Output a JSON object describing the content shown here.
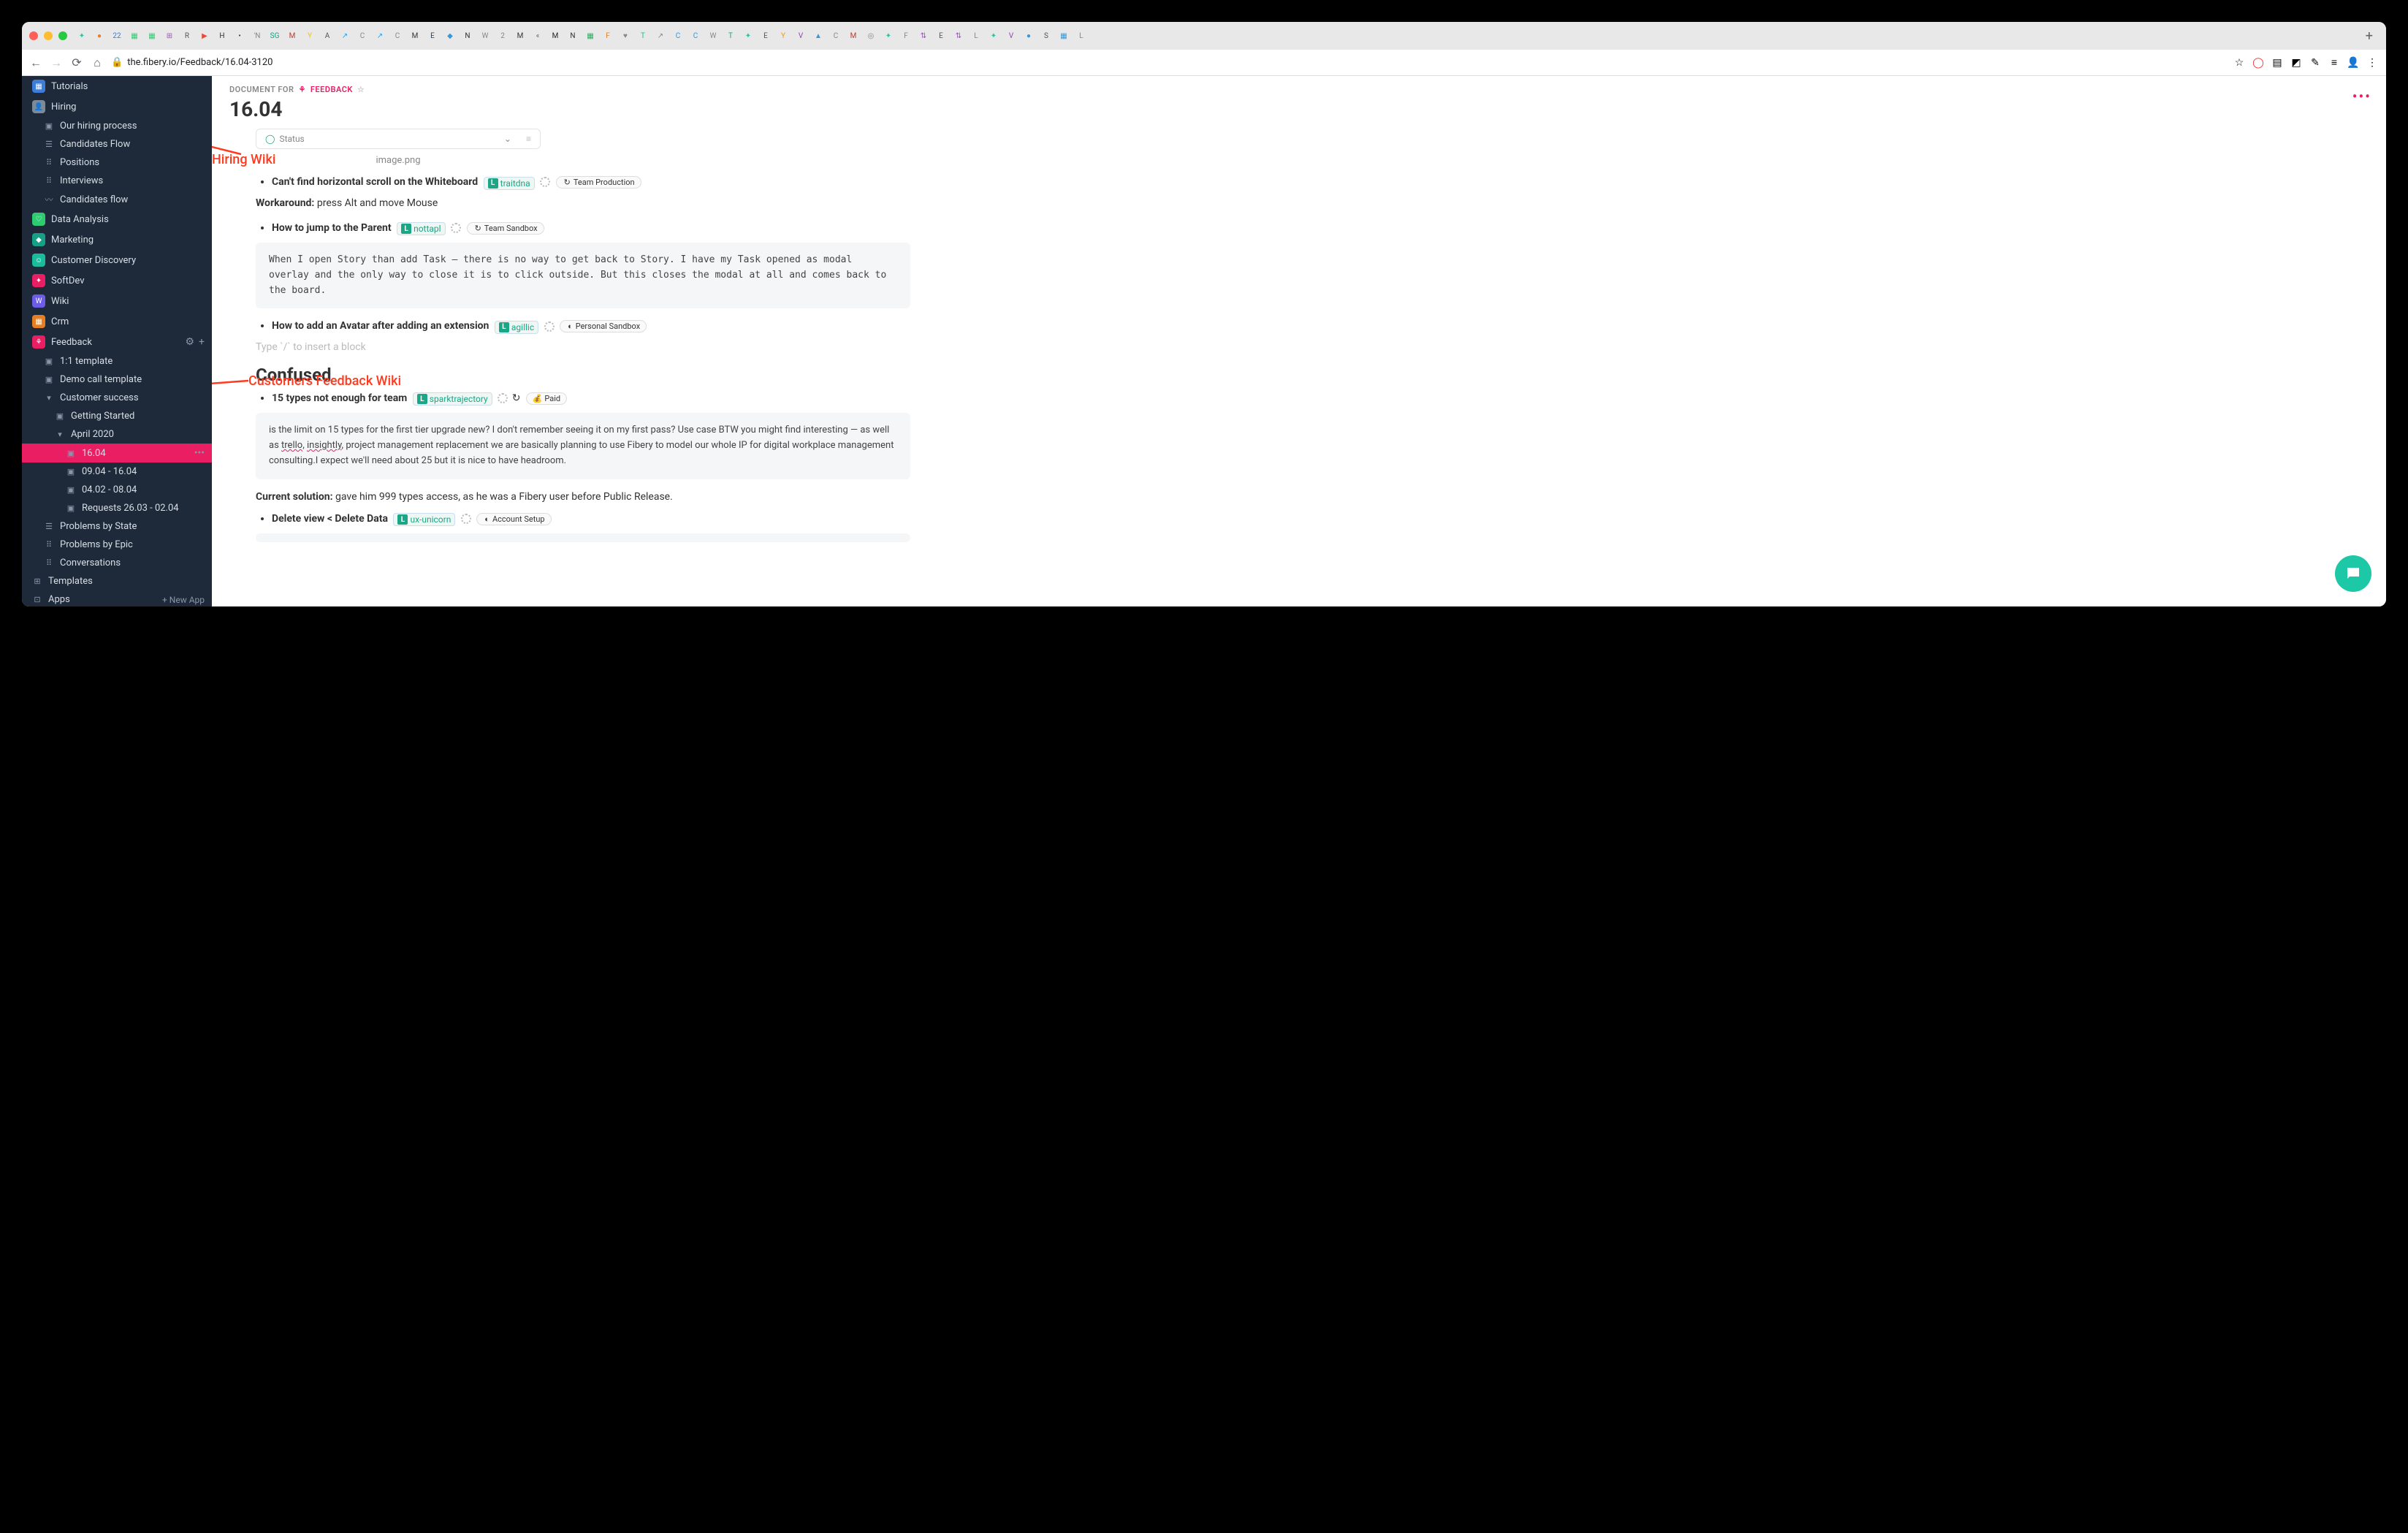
{
  "browser": {
    "url": "the.fibery.io/Feedback/16.04-3120",
    "tabs_symbols": [
      "✦",
      "●",
      "22",
      "▦",
      "▦",
      "⊞",
      "R",
      "▶",
      "H",
      "•",
      "'N",
      "SG",
      "M",
      "Y",
      "A",
      "↗",
      "C",
      "↗",
      "C",
      "M",
      "E",
      "◆",
      "N",
      "W",
      "2",
      "M",
      "«",
      "M",
      "N",
      "▦",
      "F",
      "♥",
      "T",
      "↗",
      "C",
      "C",
      "W",
      "T",
      "✦",
      "E",
      "Y",
      "V",
      "▲",
      "C",
      "M",
      "◎",
      "✦",
      "F",
      "⇅",
      "E",
      "⇅",
      "L",
      "✦",
      "V",
      "●",
      "S",
      "▦",
      "L"
    ],
    "plus": "+"
  },
  "sidebar": {
    "top": [
      {
        "icon_bg": "#3b7dd8",
        "glyph": "▦",
        "label": "Tutorials"
      },
      {
        "icon_bg": "#7a8a99",
        "glyph": "👤",
        "label": "Hiring"
      }
    ],
    "hiring_children": [
      {
        "g": "▣",
        "label": "Our hiring process"
      },
      {
        "g": "☰",
        "label": "Candidates Flow"
      },
      {
        "g": "⠿",
        "label": "Positions"
      },
      {
        "g": "⠿",
        "label": "Interviews"
      },
      {
        "g": "〰",
        "label": "Candidates flow"
      }
    ],
    "spaces": [
      {
        "icon_bg": "#2ecc71",
        "glyph": "♡",
        "label": "Data Analysis"
      },
      {
        "icon_bg": "#16a085",
        "glyph": "◆",
        "label": "Marketing"
      },
      {
        "icon_bg": "#1abc9c",
        "glyph": "☺",
        "label": "Customer Discovery"
      },
      {
        "icon_bg": "#e91e63",
        "glyph": "✦",
        "label": "SoftDev"
      },
      {
        "icon_bg": "#6c5ce7",
        "glyph": "W",
        "label": "Wiki"
      },
      {
        "icon_bg": "#e67e22",
        "glyph": "▦",
        "label": "Crm"
      },
      {
        "icon_bg": "#e91e63",
        "glyph": "⚘",
        "label": "Feedback",
        "has_actions": true
      }
    ],
    "feedback_children": [
      {
        "g": "▣",
        "label": "1:1 template"
      },
      {
        "g": "▣",
        "label": "Demo call template"
      },
      {
        "g": "▾",
        "label": "Customer success",
        "expandable": true
      }
    ],
    "customer_success_children": [
      {
        "g": "▣",
        "label": "Getting Started"
      },
      {
        "g": "▾",
        "label": "April 2020",
        "expandable": true
      }
    ],
    "april_children": [
      {
        "g": "▣",
        "label": "16.04",
        "active": true,
        "dots": "•••"
      },
      {
        "g": "▣",
        "label": "09.04 - 16.04"
      },
      {
        "g": "▣",
        "label": "04.02 - 08.04"
      },
      {
        "g": "▣",
        "label": "Requests 26.03 - 02.04"
      }
    ],
    "feedback_tail": [
      {
        "g": "☰",
        "label": "Problems by State"
      },
      {
        "g": "⠿",
        "label": "Problems by Epic"
      },
      {
        "g": "⠿",
        "label": "Conversations"
      }
    ],
    "footer": [
      {
        "g": "⊞",
        "label": "Templates"
      },
      {
        "g": "⊡",
        "label": "Apps",
        "right": "+ New App"
      }
    ]
  },
  "doc": {
    "breadcrumb_prefix": "DOCUMENT FOR",
    "breadcrumb_link": "FEEDBACK",
    "title": "16.04",
    "status_label": "Status",
    "image_caption": "image.png",
    "items_top": [
      {
        "title": "Can't find horizontal scroll on the Whiteboard",
        "tag": "traitdna",
        "chip": "Team Production"
      }
    ],
    "workaround_label": "Workaround:",
    "workaround_text": " press Alt and move Mouse",
    "item2": {
      "title": "How to jump to the Parent",
      "tag": "nottapl",
      "chip": "Team Sandbox"
    },
    "code1": "When I open Story than add Task — there is no way to get back to Story. I have my Task opened as modal overlay and the only way to close it is to click outside. But this closes the modal at all and comes back to the board.",
    "item3": {
      "title": "How to add an Avatar after adding an extension",
      "tag": "agillic",
      "chip": "Personal Sandbox"
    },
    "placeholder": "Type `/` to insert a block",
    "confused_heading": "Confused",
    "item4": {
      "title": "15 types not enough for team",
      "tag": "sparktrajectory",
      "chip": "💰  Paid"
    },
    "code2_pre": "is the limit on 15 types for the first tier upgrade new? I don't remember seeing it on my first pass? Use case BTW you might find interesting — as well as ",
    "code2_w1": "trello",
    "code2_mid1": ", ",
    "code2_w2": "insightly",
    "code2_post": ", project management replacement we are basically planning to use Fibery to model our whole IP for digital workplace management consulting.I expect we'll need about 25 but it is nice to have headroom.",
    "solution_label": "Current solution:",
    "solution_text": " gave him 999 types access, as he was a Fibery user before Public Release.",
    "item5": {
      "title": "Delete view < Delete Data",
      "tag": "ux-unicorn",
      "chip": "Account Setup"
    }
  },
  "annotations": {
    "a1": "Hiring Wiki",
    "a2": "Customers Feedback Wiki"
  }
}
